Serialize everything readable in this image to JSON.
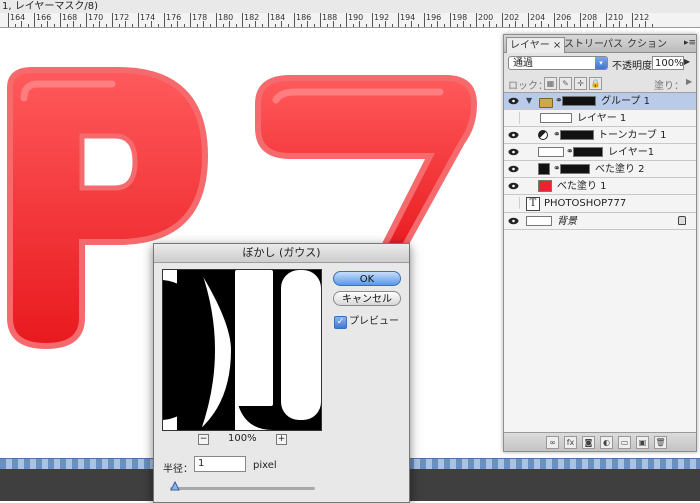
{
  "window": {
    "title": "1, レイヤーマスク/8)"
  },
  "ruler": {
    "labels": [
      "164",
      "166",
      "168",
      "170",
      "172",
      "174",
      "176",
      "178",
      "180",
      "182",
      "184",
      "186",
      "188",
      "190",
      "192",
      "194",
      "196",
      "198",
      "200",
      "202",
      "204",
      "206",
      "208",
      "210",
      "212"
    ]
  },
  "layers_panel": {
    "tabs": [
      {
        "label": "レイヤー ×",
        "active": true
      },
      {
        "label": "ストリー",
        "active": false
      },
      {
        "label": "パス",
        "active": false
      },
      {
        "label": "クション",
        "active": false
      }
    ],
    "menu_icon": "panel-menu-icon",
    "blend_mode": "通過",
    "opacity_label": "不透明度：",
    "opacity_value": "100%",
    "lock_label": "ロック：",
    "fill_label": "塗り：",
    "layers": [
      {
        "name": "グループ 1",
        "selected": true
      },
      {
        "name": "レイヤー 1",
        "selected": false
      },
      {
        "name": "トーンカーブ 1",
        "selected": false
      },
      {
        "name": "レイヤー1",
        "selected": false
      },
      {
        "name": "べた塗り 2",
        "selected": false
      },
      {
        "name": "べた塗り 1",
        "selected": false
      },
      {
        "name": "PHOTOSHOP777",
        "selected": false
      },
      {
        "name": "背景",
        "selected": false
      }
    ],
    "text_layer_glyph": "T"
  },
  "dialog": {
    "title": "ぼかし (ガウス)",
    "ok": "OK",
    "cancel": "キャンセル",
    "preview_label": "プレビュー",
    "preview_checked": true,
    "zoom_minus": "−",
    "zoom_plus": "+",
    "zoom": "100%",
    "radius_label": "半径：",
    "radius_value": "1",
    "radius_unit": "pixel"
  },
  "colors": {
    "accent": "#3f77d2",
    "art_red": "#f02a2e",
    "selection": "#b9cbe9"
  }
}
